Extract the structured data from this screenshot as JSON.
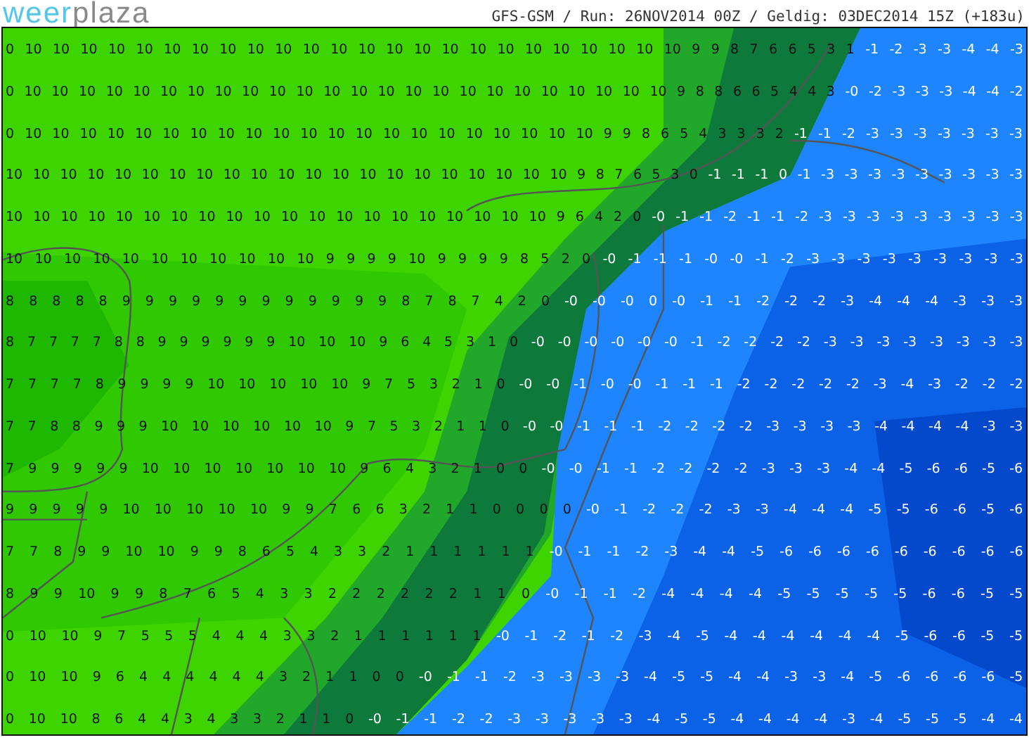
{
  "header": {
    "logo": {
      "first": "weer",
      "second": "plaza"
    },
    "title": "GFS-GSM / Run: 26NOV2014 00Z / Geldig: 03DEC2014 15Z (+183u)"
  },
  "map": {
    "rows": [
      {
        "dark_text": [
          "0",
          "10",
          "10",
          "10",
          "10",
          "10",
          "10",
          "10",
          "10",
          "10",
          "10",
          "10",
          "10",
          "10",
          "10",
          "10",
          "10",
          "10",
          "10",
          "10",
          "10",
          "10",
          "10",
          "10",
          "10",
          "9",
          "9",
          "8",
          "7",
          "6",
          "6",
          "5",
          "3",
          "1"
        ],
        "light_text": [
          "-1",
          "-2",
          "-3",
          "-3",
          "-4",
          "-4",
          "-3"
        ]
      },
      {
        "dark_text": [
          "0",
          "10",
          "10",
          "10",
          "10",
          "10",
          "10",
          "10",
          "10",
          "10",
          "10",
          "10",
          "10",
          "10",
          "10",
          "10",
          "10",
          "10",
          "10",
          "10",
          "10",
          "10",
          "10",
          "10",
          "10",
          "9",
          "8",
          "8",
          "6",
          "6",
          "5",
          "4",
          "4",
          "3"
        ],
        "light_text": [
          "-0",
          "-2",
          "-3",
          "-3",
          "-3",
          "-4",
          "-4",
          "-2"
        ]
      },
      {
        "dark_text": [
          "0",
          "10",
          "10",
          "10",
          "10",
          "10",
          "10",
          "10",
          "10",
          "10",
          "10",
          "10",
          "10",
          "10",
          "10",
          "10",
          "10",
          "10",
          "10",
          "10",
          "10",
          "10",
          "9",
          "9",
          "8",
          "6",
          "5",
          "4",
          "3",
          "3",
          "3",
          "2"
        ],
        "light_text": [
          "-1",
          "-1",
          "-2",
          "-3",
          "-3",
          "-3",
          "-3",
          "-3",
          "-3",
          "-3"
        ]
      },
      {
        "dark_text": [
          "10",
          "10",
          "10",
          "10",
          "10",
          "10",
          "10",
          "10",
          "10",
          "10",
          "10",
          "10",
          "10",
          "10",
          "10",
          "10",
          "10",
          "10",
          "10",
          "10",
          "10",
          "9",
          "8",
          "7",
          "6",
          "5",
          "3",
          "0"
        ],
        "light_text": [
          "-1",
          "-1",
          "-1",
          "0",
          "-1",
          "-3",
          "-3",
          "-3",
          "-3",
          "-3",
          "-3",
          "-3",
          "-3",
          "-3"
        ]
      },
      {
        "dark_text": [
          "10",
          "10",
          "10",
          "10",
          "10",
          "10",
          "10",
          "10",
          "10",
          "10",
          "10",
          "10",
          "10",
          "10",
          "10",
          "10",
          "10",
          "10",
          "10",
          "10",
          "9",
          "6",
          "4",
          "2",
          "0"
        ],
        "light_text": [
          "-0",
          "-1",
          "-1",
          "-2",
          "-1",
          "-1",
          "-2",
          "-3",
          "-3",
          "-3",
          "-3",
          "-3",
          "-3",
          "-3",
          "-3",
          "-3"
        ]
      },
      {
        "dark_text": [
          "10",
          "10",
          "10",
          "10",
          "10",
          "10",
          "10",
          "10",
          "10",
          "10",
          "10",
          "9",
          "9",
          "9",
          "9",
          "10",
          "9",
          "9",
          "9",
          "9",
          "8",
          "5",
          "2",
          "0"
        ],
        "light_text": [
          "-0",
          "-1",
          "-1",
          "-1",
          "-0",
          "-0",
          "-1",
          "-2",
          "-3",
          "-3",
          "-3",
          "-3",
          "-3",
          "-3",
          "-3",
          "-3",
          "-3"
        ]
      },
      {
        "dark_text": [
          "8",
          "8",
          "8",
          "8",
          "8",
          "9",
          "9",
          "9",
          "9",
          "9",
          "9",
          "9",
          "9",
          "9",
          "9",
          "9",
          "9",
          "8",
          "7",
          "8",
          "7",
          "4",
          "2",
          "0"
        ],
        "light_text": [
          "-0",
          "-0",
          "-0",
          "0",
          "-0",
          "-1",
          "-1",
          "-2",
          "-2",
          "-2",
          "-3",
          "-4",
          "-4",
          "-4",
          "-3",
          "-3",
          "-3"
        ]
      },
      {
        "dark_text": [
          "8",
          "7",
          "7",
          "7",
          "7",
          "8",
          "8",
          "9",
          "9",
          "9",
          "9",
          "9",
          "9",
          "10",
          "10",
          "10",
          "9",
          "6",
          "4",
          "5",
          "3",
          "1",
          "0"
        ],
        "light_text": [
          "-0",
          "-0",
          "-0",
          "-0",
          "-0",
          "-0",
          "-1",
          "-2",
          "-2",
          "-2",
          "-2",
          "-3",
          "-3",
          "-3",
          "-3",
          "-3",
          "-3",
          "-3",
          "-3"
        ]
      },
      {
        "dark_text": [
          "7",
          "7",
          "7",
          "7",
          "8",
          "9",
          "9",
          "9",
          "9",
          "10",
          "10",
          "10",
          "10",
          "10",
          "9",
          "7",
          "5",
          "3",
          "2",
          "1",
          "0"
        ],
        "light_text": [
          "-0",
          "-0",
          "-1",
          "-0",
          "-0",
          "-1",
          "-1",
          "-1",
          "-2",
          "-2",
          "-2",
          "-2",
          "-2",
          "-3",
          "-4",
          "-3",
          "-2",
          "-2",
          "-2"
        ]
      },
      {
        "dark_text": [
          "7",
          "7",
          "8",
          "8",
          "9",
          "9",
          "9",
          "10",
          "10",
          "10",
          "10",
          "10",
          "10",
          "9",
          "7",
          "5",
          "3",
          "2",
          "1",
          "1",
          "0"
        ],
        "light_text": [
          "-0",
          "-0",
          "-1",
          "-1",
          "-1",
          "-2",
          "-2",
          "-2",
          "-2",
          "-3",
          "-3",
          "-3",
          "-3",
          "-4",
          "-4",
          "-4",
          "-4",
          "-3",
          "-3"
        ]
      },
      {
        "dark_text": [
          "7",
          "9",
          "9",
          "9",
          "9",
          "9",
          "10",
          "10",
          "10",
          "10",
          "10",
          "10",
          "10",
          "9",
          "6",
          "4",
          "3",
          "2",
          "1",
          "0",
          "0"
        ],
        "light_text": [
          "-0",
          "-0",
          "-1",
          "-1",
          "-2",
          "-2",
          "-2",
          "-2",
          "-3",
          "-3",
          "-3",
          "-4",
          "-4",
          "-5",
          "-6",
          "-6",
          "-5",
          "-6"
        ]
      },
      {
        "dark_text": [
          "9",
          "9",
          "9",
          "9",
          "9",
          "10",
          "10",
          "10",
          "10",
          "10",
          "9",
          "9",
          "7",
          "6",
          "6",
          "3",
          "2",
          "1",
          "1",
          "0",
          "0",
          "0",
          "0"
        ],
        "light_text": [
          "-0",
          "-1",
          "-2",
          "-2",
          "-2",
          "-3",
          "-3",
          "-4",
          "-4",
          "-4",
          "-5",
          "-5",
          "-6",
          "-6",
          "-5",
          "-6"
        ]
      },
      {
        "dark_text": [
          "7",
          "7",
          "8",
          "9",
          "9",
          "10",
          "10",
          "9",
          "9",
          "8",
          "6",
          "5",
          "4",
          "3",
          "3",
          "2",
          "1",
          "1",
          "1",
          "1",
          "1",
          "1"
        ],
        "light_text": [
          "-0",
          "-1",
          "-1",
          "-2",
          "-3",
          "-4",
          "-4",
          "-5",
          "-6",
          "-6",
          "-6",
          "-6",
          "-6",
          "-6",
          "-6",
          "-6",
          "-6"
        ]
      },
      {
        "dark_text": [
          "8",
          "9",
          "9",
          "10",
          "9",
          "9",
          "8",
          "7",
          "6",
          "5",
          "4",
          "3",
          "3",
          "2",
          "2",
          "2",
          "2",
          "2",
          "2",
          "1",
          "1",
          "0"
        ],
        "light_text": [
          "-0",
          "-1",
          "-1",
          "-2",
          "-4",
          "-4",
          "-4",
          "-4",
          "-5",
          "-5",
          "-5",
          "-5",
          "-5",
          "-6",
          "-6",
          "-5",
          "-5"
        ]
      },
      {
        "dark_text": [
          "0",
          "10",
          "10",
          "9",
          "7",
          "5",
          "5",
          "5",
          "4",
          "4",
          "4",
          "3",
          "3",
          "2",
          "1",
          "1",
          "1",
          "1",
          "1",
          "1"
        ],
        "light_text": [
          "-0",
          "-1",
          "-2",
          "-1",
          "-2",
          "-3",
          "-4",
          "-5",
          "-4",
          "-4",
          "-4",
          "-4",
          "-4",
          "-4",
          "-5",
          "-6",
          "-6",
          "-5",
          "-5"
        ]
      },
      {
        "dark_text": [
          "0",
          "10",
          "10",
          "9",
          "6",
          "4",
          "4",
          "4",
          "4",
          "4",
          "4",
          "3",
          "2",
          "1",
          "1",
          "0",
          "0"
        ],
        "light_text": [
          "-0",
          "-1",
          "-1",
          "-2",
          "-3",
          "-3",
          "-3",
          "-3",
          "-4",
          "-5",
          "-5",
          "-4",
          "-4",
          "-3",
          "-3",
          "-4",
          "-5",
          "-6",
          "-6",
          "-6",
          "-6",
          "-5"
        ]
      },
      {
        "dark_text": [
          "0",
          "10",
          "10",
          "8",
          "6",
          "4",
          "4",
          "3",
          "4",
          "3",
          "3",
          "2",
          "1",
          "1",
          "0"
        ],
        "light_text": [
          "-0",
          "-1",
          "-1",
          "-2",
          "-2",
          "-3",
          "-3",
          "-3",
          "-3",
          "-3",
          "-4",
          "-5",
          "-5",
          "-4",
          "-4",
          "-4",
          "-4",
          "-3",
          "-4",
          "-5",
          "-5",
          "-5",
          "-4",
          "-4"
        ]
      }
    ]
  }
}
